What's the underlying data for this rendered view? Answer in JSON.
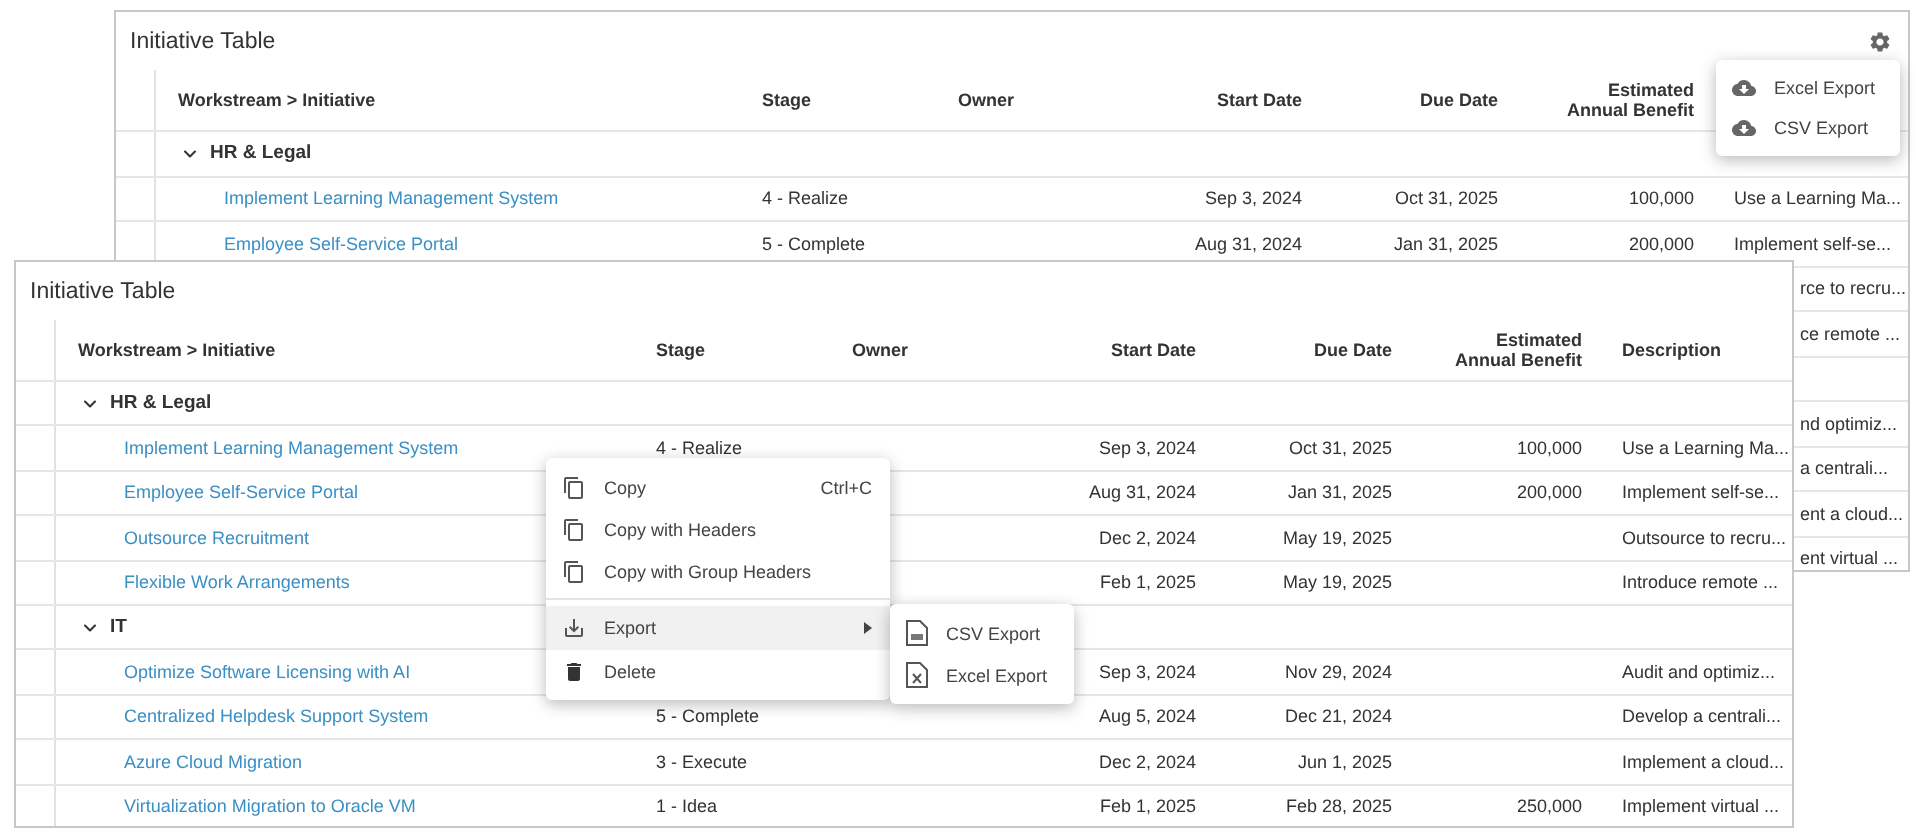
{
  "back_window": {
    "title": "Initiative Table",
    "columns": [
      "Workstream > Initiative",
      "Stage",
      "Owner",
      "Start Date",
      "Due Date",
      "Estimated Annual Benefit"
    ],
    "rows": [
      {
        "kind": "group",
        "label": "HR & Legal",
        "expanded": true
      },
      {
        "kind": "item",
        "initiative": "Implement Learning Management System",
        "stage": "4 - Realize",
        "start_date": "Sep 3, 2024",
        "due_date": "Oct 31, 2025",
        "benefit": "100,000",
        "description": "Use a Learning Ma..."
      },
      {
        "kind": "item",
        "initiative": "Employee Self-Service Portal",
        "stage": "5 - Complete",
        "start_date": "Aug 31, 2024",
        "due_date": "Jan 31, 2025",
        "benefit": "200,000",
        "description": "Implement self-se..."
      },
      {
        "kind": "item",
        "description": "rce to recru..."
      },
      {
        "kind": "item",
        "description": "ce remote ..."
      },
      {
        "kind": "group"
      },
      {
        "kind": "item",
        "description": "nd optimiz..."
      },
      {
        "kind": "item",
        "description": "a centrali..."
      },
      {
        "kind": "item",
        "description": "ent a cloud..."
      },
      {
        "kind": "item",
        "description": "ent virtual ..."
      }
    ],
    "settings_menu": [
      {
        "label": "Excel Export"
      },
      {
        "label": "CSV Export"
      }
    ]
  },
  "front_window": {
    "title": "Initiative Table",
    "columns": [
      "Workstream > Initiative",
      "Stage",
      "Owner",
      "Start Date",
      "Due Date",
      "Estimated Annual Benefit",
      "Description"
    ],
    "rows": [
      {
        "kind": "group",
        "label": "HR & Legal",
        "expanded": true
      },
      {
        "kind": "item",
        "initiative": "Implement Learning Management System",
        "stage": "4 - Realize",
        "start_date": "Sep 3, 2024",
        "due_date": "Oct 31, 2025",
        "benefit": "100,000",
        "description": "Use a Learning Ma..."
      },
      {
        "kind": "item",
        "initiative": "Employee Self-Service Portal",
        "start_date": "Aug 31, 2024",
        "due_date": "Jan 31, 2025",
        "benefit": "200,000",
        "description": "Implement self-se..."
      },
      {
        "kind": "item",
        "initiative": "Outsource Recruitment",
        "start_date": "Dec 2, 2024",
        "due_date": "May 19, 2025",
        "description": "Outsource to recru..."
      },
      {
        "kind": "item",
        "initiative": "Flexible Work Arrangements",
        "start_date": "Feb 1, 2025",
        "due_date": "May 19, 2025",
        "description": "Introduce remote ..."
      },
      {
        "kind": "group",
        "label": "IT",
        "expanded": true
      },
      {
        "kind": "item",
        "initiative": "Optimize Software Licensing with AI",
        "start_date": "Sep 3, 2024",
        "due_date": "Nov 29, 2024",
        "description": "Audit and optimiz..."
      },
      {
        "kind": "item",
        "initiative": "Centralized Helpdesk Support System",
        "stage": "5 - Complete",
        "start_date": "Aug 5, 2024",
        "due_date": "Dec 21, 2024",
        "description": "Develop a centrali..."
      },
      {
        "kind": "item",
        "initiative": "Azure Cloud Migration",
        "stage": "3 - Execute",
        "start_date": "Dec 2, 2024",
        "due_date": "Jun 1, 2025",
        "description": "Implement a cloud..."
      },
      {
        "kind": "item",
        "initiative": "Virtualization Migration to Oracle VM",
        "stage": "1 - Idea",
        "start_date": "Feb 1, 2025",
        "due_date": "Feb 28, 2025",
        "benefit": "250,000",
        "description": "Implement virtual ..."
      }
    ]
  },
  "context_menu": {
    "items": [
      {
        "kind": "copy",
        "label": "Copy",
        "shortcut": "Ctrl+C",
        "selected": false
      },
      {
        "kind": "copy",
        "label": "Copy with Headers",
        "selected": false
      },
      {
        "kind": "copy",
        "label": "Copy with Group Headers",
        "selected": false
      },
      {
        "kind": "separator"
      },
      {
        "kind": "export",
        "label": "Export",
        "submenu": true,
        "selected": true
      },
      {
        "kind": "delete",
        "label": "Delete",
        "selected": false
      }
    ],
    "submenu": [
      {
        "kind": "csv",
        "label": "CSV Export"
      },
      {
        "kind": "excel",
        "label": "Excel Export"
      }
    ]
  }
}
